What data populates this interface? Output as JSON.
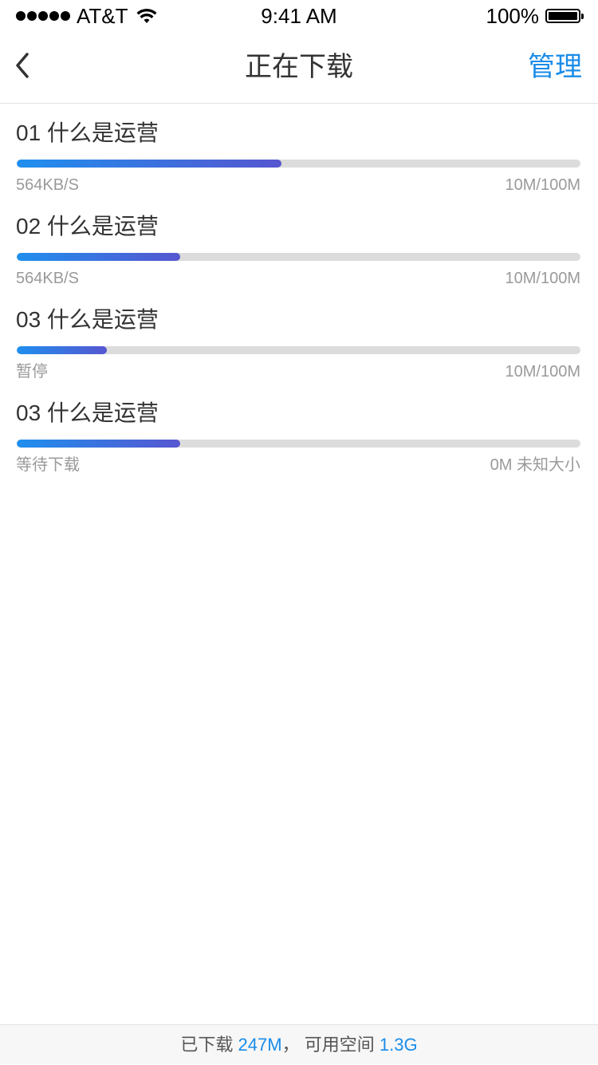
{
  "status_bar": {
    "carrier": "AT&T",
    "time": "9:41 AM",
    "battery": "100%"
  },
  "nav": {
    "title": "正在下载",
    "manage_label": "管理",
    "back_icon": "chevron-left-icon"
  },
  "colors": {
    "accent": "#1a8ce8",
    "progress_start": "#1f8fee",
    "progress_end": "#5656d0",
    "track": "#dcdcdc"
  },
  "downloads": [
    {
      "title": "01 什么是运营",
      "status": "564KB/S",
      "size": "10M/100M",
      "progress": 0.47
    },
    {
      "title": "02 什么是运营",
      "status": "564KB/S",
      "size": "10M/100M",
      "progress": 0.29
    },
    {
      "title": "03 什么是运营",
      "status": "暂停",
      "size": "10M/100M",
      "progress": 0.16
    },
    {
      "title": "03 什么是运营",
      "status": "等待下载",
      "size": "0M 未知大小",
      "progress": 0.29
    }
  ],
  "footer": {
    "downloaded_label": "已下载",
    "downloaded_value": "247M",
    "separator": "，",
    "available_label": "可用空间",
    "available_value": "1.3G"
  }
}
